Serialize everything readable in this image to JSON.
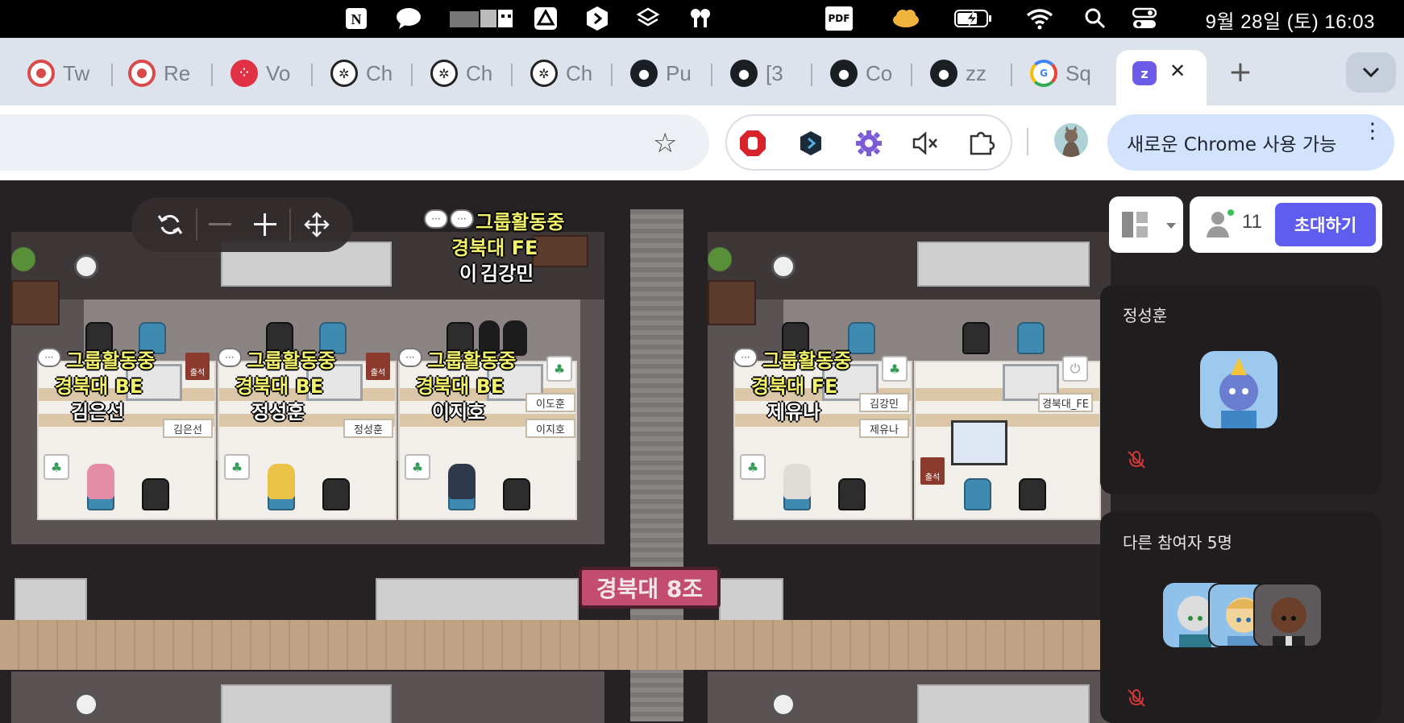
{
  "menubar": {
    "icons": [
      "notion-icon",
      "chat-bubble-icon",
      "pixel-app-icon",
      "google-drive-icon",
      "command-app-icon",
      "layers-icon",
      "airpods-icon",
      "pdf-icon",
      "cloud-icon",
      "battery-charging-icon",
      "wifi-icon",
      "search-icon",
      "control-center-icon"
    ],
    "pdf_label": "PDF",
    "clock": "9월 28일 (토) 16:03"
  },
  "tabs": [
    {
      "title": "Tw",
      "icon": "target-icon"
    },
    {
      "title": "Re",
      "icon": "target-icon"
    },
    {
      "title": "Vo",
      "icon": "twilio-icon"
    },
    {
      "title": "Ch",
      "icon": "openai-icon"
    },
    {
      "title": "Ch",
      "icon": "openai-icon"
    },
    {
      "title": "Ch",
      "icon": "openai-icon"
    },
    {
      "title": "Pu",
      "icon": "github-icon"
    },
    {
      "title": "[3",
      "icon": "github-icon"
    },
    {
      "title": "Co",
      "icon": "github-icon"
    },
    {
      "title": "zz",
      "icon": "github-icon"
    },
    {
      "title": "Sq",
      "icon": "google-icon"
    }
  ],
  "active_tab": {
    "icon": "zep-icon",
    "close": "✕"
  },
  "new_tab": "+",
  "toolbar": {
    "star": "☆",
    "extensions": [
      "adblock-icon",
      "command-ext-icon",
      "gear-ext-icon",
      "mute-icon",
      "puzzle-icon"
    ],
    "update_label": "새로운 Chrome 사용 가능"
  },
  "game": {
    "zoom_controls": [
      "refresh-icon",
      "zoom-out-icon",
      "zoom-in-icon",
      "move-icon"
    ],
    "room_sign": "경북대 8조",
    "users": [
      {
        "status": "그룹활동중",
        "team": "경북대 BE",
        "name": "김은선",
        "plate": "김은선"
      },
      {
        "status": "그룹활동중",
        "team": "경북대 BE",
        "name": "정성훈",
        "plate": "정성훈"
      },
      {
        "status": "그룹활동중",
        "team": "경북대 BE",
        "name": "이지호",
        "plate": "이지호"
      },
      {
        "status": "그룹활동중",
        "team": "경북대 FE",
        "name": "제유나",
        "plate": "제유나"
      }
    ],
    "walker": {
      "status": "그룹활동중",
      "team": "경북대 FE",
      "name": "김강민",
      "prefix": "이"
    },
    "extra_plates": [
      "이도훈",
      "김강민",
      "경북대_FE"
    ],
    "attend_label": "출석"
  },
  "panel": {
    "people_count": "11",
    "invite_label": "초대하기",
    "speaker_name": "정성훈",
    "others_label": "다른 참여자 5명"
  },
  "colors": {
    "invite": "#5f5cf0",
    "status_text": "#f3f26a",
    "room_sign": "#c24d70",
    "mute": "#d0363a"
  }
}
